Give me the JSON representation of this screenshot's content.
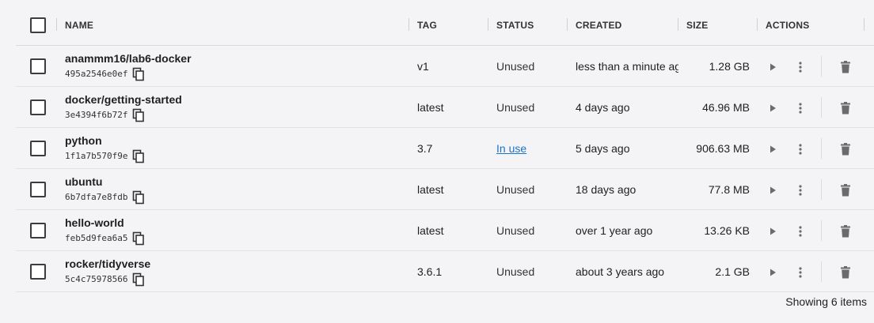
{
  "columns": {
    "name": "NAME",
    "tag": "TAG",
    "status": "STATUS",
    "created": "CREATED",
    "size": "SIZE",
    "actions": "ACTIONS"
  },
  "images": [
    {
      "name": "anammm16/lab6-docker",
      "id": "495a2546e0ef",
      "tag": "v1",
      "status": "Unused",
      "created": "less than a minute ago",
      "size": "1.28 GB"
    },
    {
      "name": "docker/getting-started",
      "id": "3e4394f6b72f",
      "tag": "latest",
      "status": "Unused",
      "created": "4 days ago",
      "size": "46.96 MB"
    },
    {
      "name": "python",
      "id": "1f1a7b570f9e",
      "tag": "3.7",
      "status": "In use",
      "created": "5 days ago",
      "size": "906.63 MB"
    },
    {
      "name": "ubuntu",
      "id": "6b7dfa7e8fdb",
      "tag": "latest",
      "status": "Unused",
      "created": "18 days ago",
      "size": "77.8 MB"
    },
    {
      "name": "hello-world",
      "id": "feb5d9fea6a5",
      "tag": "latest",
      "status": "Unused",
      "created": "over 1 year ago",
      "size": "13.26 KB"
    },
    {
      "name": "rocker/tidyverse",
      "id": "5c4c75978566",
      "tag": "3.6.1",
      "status": "Unused",
      "created": "about 3 years ago",
      "size": "2.1 GB"
    }
  ],
  "footer": {
    "count_text": "Showing 6 items"
  },
  "icons": {
    "copy": "copy-icon",
    "run": "play-icon",
    "more": "more-vertical-icon",
    "delete": "trash-icon"
  },
  "colors": {
    "link": "#1a73c8",
    "icon": "#6b6b6b"
  }
}
